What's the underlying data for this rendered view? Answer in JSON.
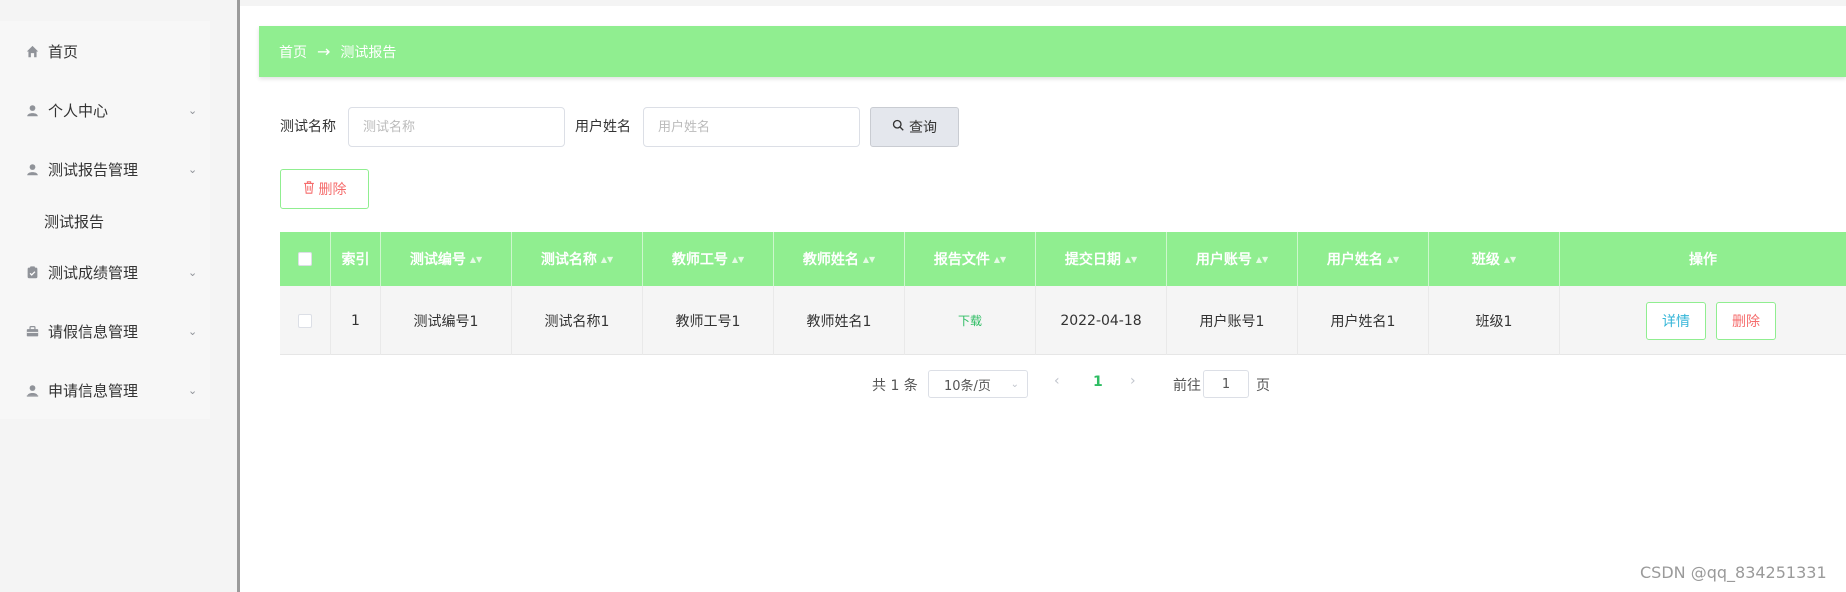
{
  "sidebar": {
    "items": [
      {
        "label": "首页",
        "icon": "home-icon"
      },
      {
        "label": "个人中心",
        "icon": "user-icon"
      },
      {
        "label": "测试报告管理",
        "icon": "user-icon"
      },
      {
        "label": "测试报告",
        "icon": ""
      },
      {
        "label": "测试成绩管理",
        "icon": "clipboard-icon"
      },
      {
        "label": "请假信息管理",
        "icon": "briefcase-icon"
      },
      {
        "label": "申请信息管理",
        "icon": "user-icon"
      }
    ]
  },
  "breadcrumb": {
    "home": "首页",
    "separator": "→",
    "current": "测试报告"
  },
  "search": {
    "test_name_label": "测试名称",
    "test_name_placeholder": "测试名称",
    "user_name_label": "用户姓名",
    "user_name_placeholder": "用户姓名",
    "query_button": "查询"
  },
  "toolbar": {
    "delete_button": "删除"
  },
  "table": {
    "columns": [
      "索引",
      "测试编号",
      "测试名称",
      "教师工号",
      "教师姓名",
      "报告文件",
      "提交日期",
      "用户账号",
      "用户姓名",
      "班级",
      "操作"
    ],
    "rows": [
      {
        "index": "1",
        "test_no": "测试编号1",
        "test_name": "测试名称1",
        "teacher_id": "教师工号1",
        "teacher_name": "教师姓名1",
        "report_file": "下载",
        "submit_date": "2022-04-18",
        "user_account": "用户账号1",
        "user_name": "用户姓名1",
        "class": "班级1",
        "detail_button": "详情",
        "delete_button": "删除"
      }
    ]
  },
  "pagination": {
    "total": "共 1 条",
    "page_size": "10条/页",
    "current_page": "1",
    "goto_label": "前往",
    "goto_value": "1",
    "page_suffix": "页"
  },
  "watermark": "CSDN @qq_834251331",
  "colors": {
    "accent": "#90ee90",
    "danger": "#f56c6c",
    "link": "#2ebd63",
    "info": "#36b6d8"
  }
}
